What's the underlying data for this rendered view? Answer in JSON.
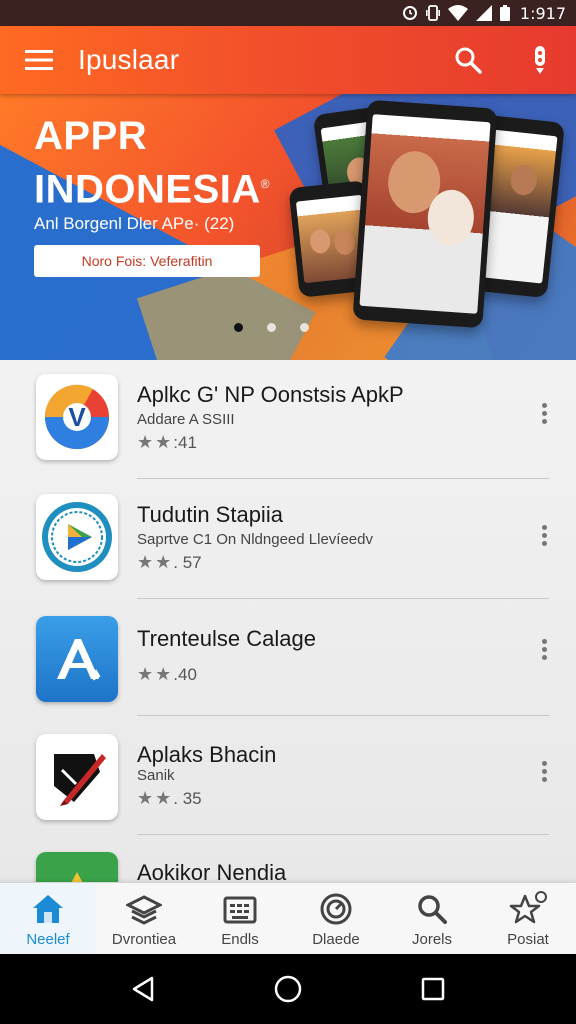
{
  "status_bar": {
    "time": "1:917"
  },
  "app_bar": {
    "title": "Ipuslaar",
    "menu_icon": "menu-icon",
    "search_icon": "search-icon",
    "overflow_icon": "more-vertical-icon"
  },
  "banner": {
    "title_line1": "APPR",
    "title_line2": "INDONESIA",
    "registered_mark": "®",
    "subtitle": "Anl Borgenl Dler APe· (22)",
    "cta_label": "Noro Fois: Veferafitin",
    "page_count": 3,
    "active_page": 1
  },
  "apps": [
    {
      "name": "Aplkc G' NP Oonstsis ApkP",
      "subtitle": "Addare A SSIII",
      "rating": ":41",
      "icon": "chrome-like-icon"
    },
    {
      "name": "Tudutin Stapiia",
      "subtitle": "Saprtve C1 On Nldngeed Llevíeedv",
      "rating": ". 57",
      "icon": "play-badge-icon"
    },
    {
      "name": "Trenteulse Calage",
      "subtitle": "",
      "rating": ".40",
      "icon": "letter-a-icon"
    },
    {
      "name": "Aplaks Bhacin",
      "subtitle": "Sanik",
      "rating": ". 35",
      "icon": "red-pen-icon"
    },
    {
      "name": "Aokikor Nendia",
      "subtitle": "",
      "rating": "",
      "icon": "green-yellow-app-icon"
    }
  ],
  "bottom_nav": [
    {
      "label": "Neelef",
      "icon": "home-icon",
      "active": true
    },
    {
      "label": "Dvrontiea",
      "icon": "layers-icon",
      "active": false
    },
    {
      "label": "Endls",
      "icon": "keyboard-icon",
      "active": false
    },
    {
      "label": "Dlaede",
      "icon": "target-icon",
      "active": false
    },
    {
      "label": "Jorels",
      "icon": "search-icon",
      "active": false
    },
    {
      "label": "Posiat",
      "icon": "star-outline-icon",
      "active": false
    }
  ],
  "colors": {
    "app_bar": "#f2502a",
    "accent": "#1c8bd6",
    "banner_blue": "#1f6fd6"
  }
}
